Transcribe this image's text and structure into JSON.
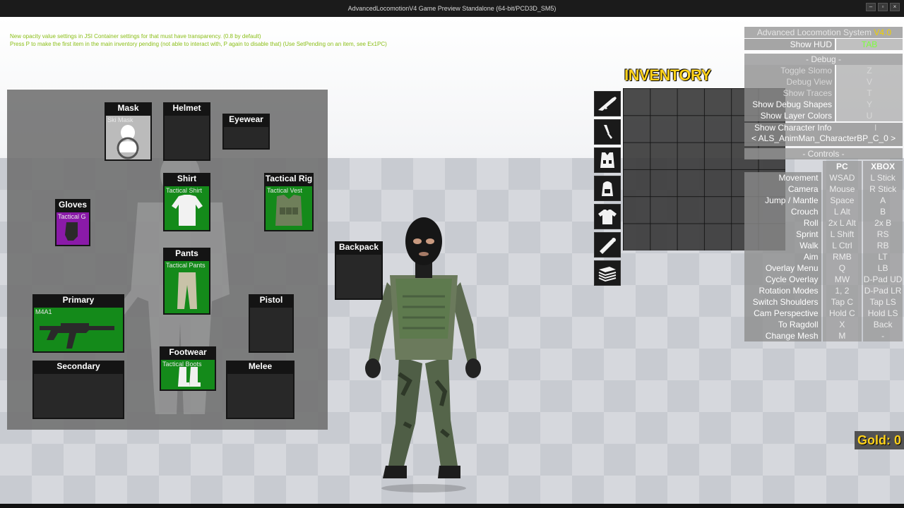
{
  "window": {
    "title": "AdvancedLocomotionV4 Game Preview Standalone (64-bit/PCD3D_SM5)"
  },
  "help": {
    "line1": "New opacity value settings in JSI Container settings for that must have transparency. (0.8 by default)",
    "line2": "Press P to make the first item in the main inventory pending (not able to interact with, P again to disable that) (Use SetPending on an item, see Ex1PC)"
  },
  "equipment": {
    "mask": {
      "label": "Mask",
      "item": "Ski Mask"
    },
    "helmet": {
      "label": "Helmet",
      "item": ""
    },
    "eyewear": {
      "label": "Eyewear",
      "item": ""
    },
    "shirt": {
      "label": "Shirt",
      "item": "Tactical Shirt"
    },
    "tactical_rig": {
      "label": "Tactical Rig",
      "item": "Tactical Vest"
    },
    "gloves": {
      "label": "Gloves",
      "item": "Tactical G"
    },
    "pants": {
      "label": "Pants",
      "item": "Tactical Pants"
    },
    "primary": {
      "label": "Primary",
      "item": "M4A1"
    },
    "pistol": {
      "label": "Pistol",
      "item": ""
    },
    "footwear": {
      "label": "Footwear",
      "item": "Tactical Boots"
    },
    "secondary": {
      "label": "Secondary",
      "item": ""
    },
    "melee": {
      "label": "Melee",
      "item": ""
    },
    "backpack": {
      "label": "Backpack",
      "item": ""
    }
  },
  "inventory": {
    "title": "INVENTORY",
    "tabs": [
      "rifle-icon",
      "knife-icon",
      "vest-icon",
      "backpack-icon",
      "shirt-icon",
      "grenade-icon",
      "money-icon"
    ]
  },
  "hud": {
    "title": "Advanced Locomotion System",
    "version": "V4.0",
    "show_hud": {
      "label": "Show HUD",
      "key": "TAB"
    },
    "debug_header": "- Debug -",
    "debug": [
      {
        "label": "Toggle Slomo",
        "key": "Z"
      },
      {
        "label": "Debug View",
        "key": "V"
      },
      {
        "label": "Show Traces",
        "key": "T"
      },
      {
        "label": "Show Debug Shapes",
        "key": "Y"
      },
      {
        "label": "Show Layer Colors",
        "key": "U"
      }
    ],
    "char_info": {
      "label": "Show Character Info",
      "key": "I",
      "value": "< ALS_AnimMan_CharacterBP_C_0 >"
    },
    "controls_header": "- Controls -",
    "col_pc": "PC",
    "col_xbox": "XBOX",
    "controls": [
      {
        "label": "Movement",
        "pc": "WSAD",
        "xbox": "L Stick"
      },
      {
        "label": "Camera",
        "pc": "Mouse",
        "xbox": "R Stick"
      },
      {
        "label": "Jump / Mantle",
        "pc": "Space",
        "xbox": "A"
      },
      {
        "label": "Crouch",
        "pc": "L Alt",
        "xbox": "B"
      },
      {
        "label": "Roll",
        "pc": "2x L Alt",
        "xbox": "2x B"
      },
      {
        "label": "Sprint",
        "pc": "L Shift",
        "xbox": "RS"
      },
      {
        "label": "Walk",
        "pc": "L Ctrl",
        "xbox": "RB"
      },
      {
        "label": "Aim",
        "pc": "RMB",
        "xbox": "LT"
      },
      {
        "label": "Overlay Menu",
        "pc": "Q",
        "xbox": "LB"
      },
      {
        "label": "Cycle Overlay State",
        "pc": "MW",
        "xbox": "D-Pad UD"
      },
      {
        "label": "Rotation Modes",
        "pc": "1, 2",
        "xbox": "D-Pad LR"
      },
      {
        "label": "Switch Shoulders",
        "pc": "Tap C",
        "xbox": "Tap LS"
      },
      {
        "label": "Cam Perspective",
        "pc": "Hold C",
        "xbox": "Hold LS"
      },
      {
        "label": "To Ragdoll",
        "pc": "X",
        "xbox": "Back"
      },
      {
        "label": "Change Mesh",
        "pc": "M",
        "xbox": "-"
      }
    ]
  },
  "gold": {
    "text": "Gold: 0"
  },
  "colors": {
    "equipped": "#148a1a",
    "rare": "#8a1aa8",
    "gold": "#ffd21a",
    "help": "#8bbf18"
  }
}
